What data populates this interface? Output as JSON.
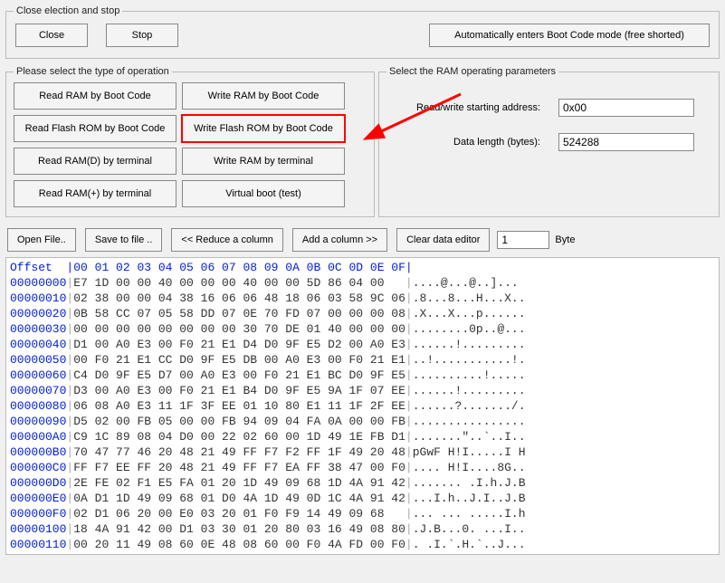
{
  "close_group": {
    "legend": "Close election and stop",
    "close": "Close",
    "stop": "Stop",
    "auto": "Automatically enters Boot Code mode (free shorted)"
  },
  "ops": {
    "legend": "Please select the type of operation",
    "read_ram_boot": "Read RAM by Boot Code",
    "write_ram_boot": "Write RAM by Boot Code",
    "read_flash_boot": "Read Flash ROM by Boot Code",
    "write_flash_boot": "Write Flash ROM by Boot Code",
    "read_ram_d_term": "Read RAM(D) by terminal",
    "write_ram_term": "Write RAM by terminal",
    "read_ram_p_term": "Read RAM(+) by terminal",
    "virtual_boot": "Virtual boot (test)"
  },
  "ram": {
    "legend": "Select the RAM operating parameters",
    "addr_label": "Read/write starting address:",
    "addr_value": "0x00",
    "len_label": "Data length (bytes):",
    "len_value": "524288"
  },
  "toolbar": {
    "open": "Open File..",
    "save": "Save to file ..",
    "reduce": "<< Reduce a column",
    "add": "Add a column >>",
    "clear": "Clear data editor",
    "byte_inp": "1",
    "byte_label": "Byte"
  },
  "hex": {
    "offset_label": "Offset",
    "cols": [
      "00",
      "01",
      "02",
      "03",
      "04",
      "05",
      "06",
      "07",
      "08",
      "09",
      "0A",
      "0B",
      "0C",
      "0D",
      "0E",
      "0F"
    ],
    "rows": [
      {
        "off": "00000000",
        "bytes": [
          "E7",
          "1D",
          "00",
          "00",
          "40",
          "00",
          "00",
          "00",
          "40",
          "00",
          "00",
          "5D",
          "86",
          "04",
          "00"
        ],
        "ascii": "....@...@..]..."
      },
      {
        "off": "00000010",
        "bytes": [
          "02",
          "38",
          "00",
          "00",
          "04",
          "38",
          "16",
          "06",
          "06",
          "48",
          "18",
          "06",
          "03",
          "58",
          "9C",
          "06"
        ],
        "ascii": ".8...8...H...X.."
      },
      {
        "off": "00000020",
        "bytes": [
          "0B",
          "58",
          "CC",
          "07",
          "05",
          "58",
          "DD",
          "07",
          "0E",
          "70",
          "FD",
          "07",
          "00",
          "00",
          "00",
          "08"
        ],
        "ascii": ".X...X...p......"
      },
      {
        "off": "00000030",
        "bytes": [
          "00",
          "00",
          "00",
          "00",
          "00",
          "00",
          "00",
          "00",
          "30",
          "70",
          "DE",
          "01",
          "40",
          "00",
          "00",
          "00"
        ],
        "ascii": "........0p..@..."
      },
      {
        "off": "00000040",
        "bytes": [
          "D1",
          "00",
          "A0",
          "E3",
          "00",
          "F0",
          "21",
          "E1",
          "D4",
          "D0",
          "9F",
          "E5",
          "D2",
          "00",
          "A0",
          "E3"
        ],
        "ascii": "......!........."
      },
      {
        "off": "00000050",
        "bytes": [
          "00",
          "F0",
          "21",
          "E1",
          "CC",
          "D0",
          "9F",
          "E5",
          "DB",
          "00",
          "A0",
          "E3",
          "00",
          "F0",
          "21",
          "E1"
        ],
        "ascii": "..!...........!."
      },
      {
        "off": "00000060",
        "bytes": [
          "C4",
          "D0",
          "9F",
          "E5",
          "D7",
          "00",
          "A0",
          "E3",
          "00",
          "F0",
          "21",
          "E1",
          "BC",
          "D0",
          "9F",
          "E5"
        ],
        "ascii": "..........!....."
      },
      {
        "off": "00000070",
        "bytes": [
          "D3",
          "00",
          "A0",
          "E3",
          "00",
          "F0",
          "21",
          "E1",
          "B4",
          "D0",
          "9F",
          "E5",
          "9A",
          "1F",
          "07",
          "EE"
        ],
        "ascii": "......!........."
      },
      {
        "off": "00000080",
        "bytes": [
          "06",
          "08",
          "A0",
          "E3",
          "11",
          "1F",
          "3F",
          "EE",
          "01",
          "10",
          "80",
          "E1",
          "11",
          "1F",
          "2F",
          "EE"
        ],
        "ascii": "......?......./."
      },
      {
        "off": "00000090",
        "bytes": [
          "D5",
          "02",
          "00",
          "FB",
          "05",
          "00",
          "00",
          "FB",
          "94",
          "09",
          "04",
          "FA",
          "0A",
          "00",
          "00",
          "FB"
        ],
        "ascii": "................"
      },
      {
        "off": "000000A0",
        "bytes": [
          "C9",
          "1C",
          "89",
          "08",
          "04",
          "D0",
          "00",
          "22",
          "02",
          "60",
          "00",
          "1D",
          "49",
          "1E",
          "FB",
          "D1"
        ],
        "ascii": ".......\"..`..I.."
      },
      {
        "off": "000000B0",
        "bytes": [
          "70",
          "47",
          "77",
          "46",
          "20",
          "48",
          "21",
          "49",
          "FF",
          "F7",
          "F2",
          "FF",
          "1F",
          "49",
          "20",
          "48"
        ],
        "ascii": "pGwF H!I.....I H"
      },
      {
        "off": "000000C0",
        "bytes": [
          "FF",
          "F7",
          "EE",
          "FF",
          "20",
          "48",
          "21",
          "49",
          "FF",
          "F7",
          "EA",
          "FF",
          "38",
          "47",
          "00",
          "F0"
        ],
        "ascii": ".... H!I....8G.."
      },
      {
        "off": "000000D0",
        "bytes": [
          "2E",
          "FE",
          "02",
          "F1",
          "E5",
          "FA",
          "01",
          "20",
          "1D",
          "49",
          "09",
          "68",
          "1D",
          "4A",
          "91",
          "42"
        ],
        "ascii": "....... .I.h.J.B"
      },
      {
        "off": "000000E0",
        "bytes": [
          "0A",
          "D1",
          "1D",
          "49",
          "09",
          "68",
          "01",
          "D0",
          "4A",
          "1D",
          "49",
          "0D",
          "1C",
          "4A",
          "91",
          "42"
        ],
        "ascii": "...I.h..J.I..J.B"
      },
      {
        "off": "000000F0",
        "bytes": [
          "02",
          "D1",
          "06",
          "20",
          "00",
          "E0",
          "03",
          "20",
          "01",
          "F0",
          "F9",
          "14",
          "49",
          "09",
          "68",
          ""
        ],
        "ascii": "... ... .....I.h"
      },
      {
        "off": "00000100",
        "bytes": [
          "18",
          "4A",
          "91",
          "42",
          "00",
          "D1",
          "03",
          "30",
          "01",
          "20",
          "80",
          "03",
          "16",
          "49",
          "08",
          "80"
        ],
        "ascii": ".J.B...0. ...I.."
      },
      {
        "off": "00000110",
        "bytes": [
          "00",
          "20",
          "11",
          "49",
          "08",
          "60",
          "0E",
          "48",
          "08",
          "60",
          "00",
          "F0",
          "4A",
          "FD",
          "00",
          "F0"
        ],
        "ascii": ". .I.`.H.`..J..."
      }
    ]
  }
}
